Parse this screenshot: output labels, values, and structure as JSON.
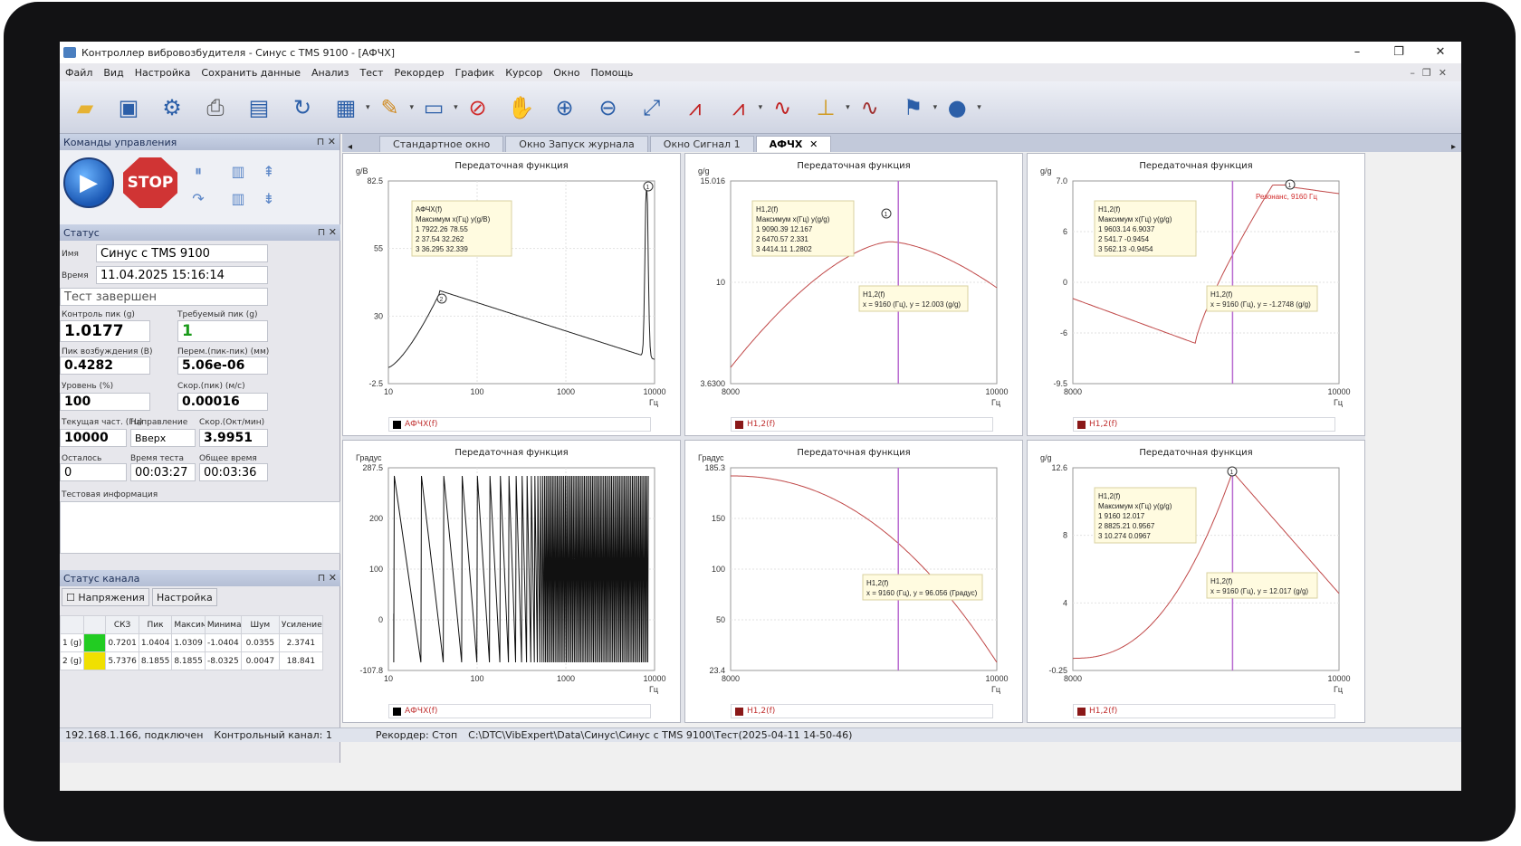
{
  "window": {
    "title": "Контроллер вибровозбудителя - Синус с TMS 9100 - [АФЧХ]"
  },
  "menu": [
    "Файл",
    "Вид",
    "Настройка",
    "Сохранить данные",
    "Анализ",
    "Тест",
    "Рекордер",
    "График",
    "Курсор",
    "Окно",
    "Помощь"
  ],
  "panels": {
    "commands": "Команды управления",
    "status": "Статус",
    "channel": "Статус канала"
  },
  "control": {
    "stop_label": "STOP"
  },
  "status": {
    "name_label": "Имя",
    "name": "Синус с TMS 9100",
    "time_label": "Время",
    "time": "11.04.2025 15:16:14",
    "state": "Тест завершен",
    "control_peak_label": "Контроль пик (g)",
    "control_peak": "1.0177",
    "required_peak_label": "Требуемый пик (g)",
    "required_peak": "1",
    "excite_peak_label": "Пик возбуждения (В)",
    "excite_peak": "0.4282",
    "displacement_label": "Перем.(пик-пик) (мм)",
    "displacement": "5.06e-06",
    "level_label": "Уровень (%)",
    "level": "100",
    "velocity_label": "Скор.(пик) (м/с)",
    "velocity": "0.00016",
    "freq_label": "Текущая част. (Гц)",
    "direction_label": "Направление",
    "sweep_label": "Скор.(Окт/мин)",
    "freq": "10000",
    "direction": "Вверх",
    "sweep": "3.9951",
    "remaining_label": "Осталось",
    "elapsed_label": "Время теста",
    "total_label": "Общее время",
    "remaining": "0",
    "elapsed": "00:03:27",
    "total": "00:03:36",
    "info_label": "Тестовая информация"
  },
  "channel": {
    "voltage_label": "Напряжения",
    "settings_label": "Настройка",
    "headers": [
      "",
      "",
      "СКЗ",
      "Пик",
      "Максимальный",
      "Минимальный",
      "Шум",
      "Усиление(Б)"
    ],
    "rows": [
      {
        "name": "1 (g)",
        "color": "#22cc22",
        "cells": [
          "0.7201",
          "1.0404",
          "1.0309",
          "-1.0404",
          "0.0355",
          "2.3741"
        ]
      },
      {
        "name": "2 (g)",
        "color": "#f0e000",
        "cells": [
          "5.7376",
          "8.1855",
          "8.1855",
          "-8.0325",
          "0.0047",
          "18.841"
        ]
      }
    ]
  },
  "tabs": [
    "Стандартное окно",
    "Окно Запуск журнала",
    "Окно Сигнал 1",
    "АФЧХ"
  ],
  "plots": [
    {
      "title": "Передаточная функция",
      "unit": "g/В",
      "xunit": "Гц",
      "legend": "АФЧХ(f)",
      "ticks_y": [
        "82.5",
        "55",
        "30",
        "-2.5"
      ],
      "ticks_x": [
        "10",
        "100",
        "1000",
        "10000"
      ]
    },
    {
      "title": "Передаточная функция",
      "unit": "g/g",
      "xunit": "Гц",
      "legend": "H1,2(f)",
      "ticks_y": [
        "15.016",
        "10",
        "3.6300"
      ],
      "ticks_x": [
        "8000",
        "10000"
      ]
    },
    {
      "title": "Передаточная функция",
      "unit": "g/g",
      "xunit": "Гц",
      "legend": "H1,2(f)",
      "ticks_y": [
        "7.0",
        "6",
        "0",
        "-6",
        "-9.5"
      ],
      "ticks_x": [
        "8000",
        "10000"
      ]
    },
    {
      "title": "Передаточная функция",
      "unit": "Градус",
      "xunit": "Гц",
      "legend": "АФЧХ(f)",
      "ticks_y": [
        "287.5",
        "200",
        "100",
        "0",
        "-107.8"
      ],
      "ticks_x": [
        "10",
        "100",
        "1000",
        "10000"
      ]
    },
    {
      "title": "Передаточная функция",
      "unit": "Градус",
      "xunit": "Гц",
      "legend": "H1,2(f)",
      "ticks_y": [
        "185.3",
        "150",
        "100",
        "50",
        "23.4"
      ],
      "ticks_x": [
        "8000",
        "10000"
      ]
    },
    {
      "title": "Передаточная функция",
      "unit": "g/g",
      "xunit": "Гц",
      "legend": "H1,2(f)",
      "ticks_y": [
        "12.6",
        "8",
        "4",
        "-0.25"
      ],
      "ticks_x": [
        "8000",
        "10000"
      ]
    }
  ],
  "annotations": {
    "p1_box": [
      "АФЧХ(f)",
      "Максимум x(Гц)   y(g/В)",
      "1     7922.26   78.55",
      "2     37.54    32.262",
      "3     36.295   32.339"
    ],
    "p2_box": [
      "H1,2(f)",
      "Максимум x(Гц)   y(g/g)",
      "1     9090.39   12.167",
      "2     6470.57   2.331",
      "3     4414.11   1.2802"
    ],
    "p2_cursor": [
      "H1,2(f)",
      "x = 9160 (Гц), y = 12.003 (g/g)"
    ],
    "p3_box": [
      "H1,2(f)",
      "Максимум x(Гц)   y(g/g)",
      "1     9603.14   6.9037",
      "2     541.7    -0.9454",
      "3     562.13   -0.9454"
    ],
    "p3_cursor": [
      "H1,2(f)",
      "x = 9160 (Гц), y = -1.2748 (g/g)"
    ],
    "p3_red": "Резонанс, 9160 Гц",
    "p5_cursor": [
      "H1,2(f)",
      "x = 9160 (Гц), y = 96.056 (Градус)"
    ],
    "p6_box": [
      "H1,2(f)",
      "Максимум x(Гц)   y(g/g)",
      "1     9160     12.017",
      "2     8825.21  0.9567",
      "3     10.274   0.0967"
    ],
    "p6_cursor": [
      "H1,2(f)",
      "x = 9160 (Гц), y = 12.017 (g/g)"
    ]
  },
  "statusbar": {
    "connection": "192.168.1.166, подключен",
    "control_channel": "Контрольный канал: 1",
    "recorder": "Рекордер: Стоп",
    "path": "C:\\DTC\\VibExpert\\Data\\Синус\\Синус с TMS 9100\\Тест(2025-04-11 14-50-46)"
  }
}
